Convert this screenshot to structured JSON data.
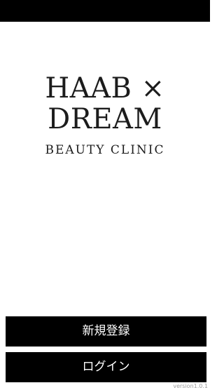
{
  "logo": {
    "line1": "HAAB ×",
    "line2": "DREAM",
    "tagline": "BEAUTY CLINIC"
  },
  "actions": {
    "register_label": "新規登録",
    "login_label": "ログイン"
  },
  "footer": {
    "version": "version1.0.1"
  }
}
